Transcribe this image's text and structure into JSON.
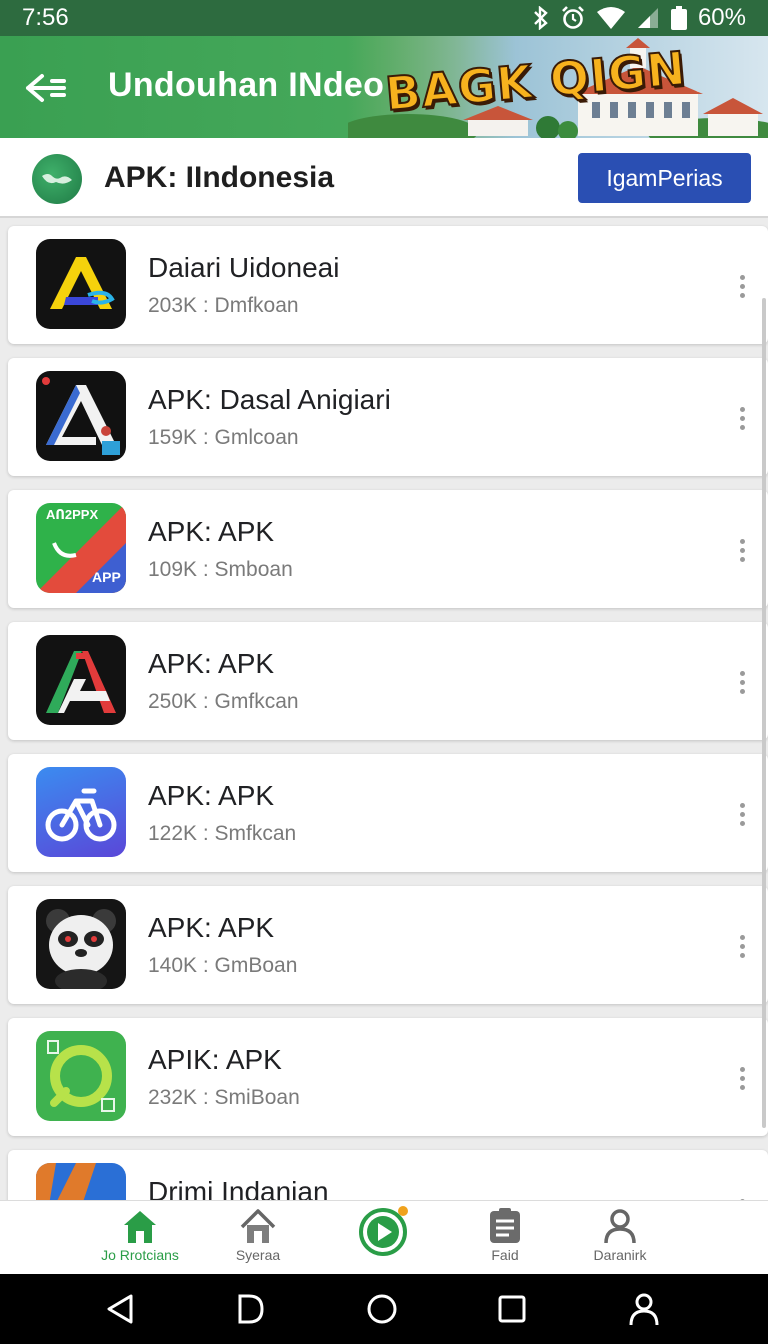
{
  "status_bar": {
    "time": "7:56",
    "battery": "60%"
  },
  "app_bar": {
    "title": "Undouhan INdeo",
    "banner_text": "BAGK QIGN"
  },
  "header": {
    "title": "APK: IIndonesia",
    "button_label": "IgamPerias"
  },
  "apps": [
    {
      "name": "Daiari Uidoneai",
      "meta": "203K : Dmfkoan",
      "icon": "letter-a-yellow-icon"
    },
    {
      "name": "APK: Dasal Anigiari",
      "meta": "159K : Gmlcoan",
      "icon": "letter-a-white-icon"
    },
    {
      "name": "APK: APK",
      "meta": "109K : Smboan",
      "icon": "apk-multicolor-icon",
      "icon_text_top": "AՈ2PPX",
      "icon_text_bottom": "APP"
    },
    {
      "name": "APK: APK",
      "meta": "250K : Gmfkcan",
      "icon": "letter-a-red-green-icon"
    },
    {
      "name": "APK: APK",
      "meta": "122K : Smfkcan",
      "icon": "bicycle-icon"
    },
    {
      "name": "APK: APK",
      "meta": "140K : GmBoan",
      "icon": "panda-icon"
    },
    {
      "name": "APIK: APK",
      "meta": "232K : SmiBoan",
      "icon": "green-ring-icon"
    },
    {
      "name": "Drimi Indanian",
      "meta": "",
      "icon": "blue-orange-icon"
    }
  ],
  "bottom_nav": [
    {
      "label": "Jo Rrotcians",
      "icon": "home-icon",
      "active": true
    },
    {
      "label": "Syeraa",
      "icon": "house-outline-icon",
      "active": false
    },
    {
      "label": "",
      "icon": "play-circle-icon",
      "active": false
    },
    {
      "label": "Faid",
      "icon": "list-icon",
      "active": false
    },
    {
      "label": "Daranirk",
      "icon": "person-icon",
      "active": false
    }
  ],
  "colors": {
    "primary_green": "#3aa052",
    "button_blue": "#2a4fb3",
    "active_nav": "#2a9d47"
  }
}
